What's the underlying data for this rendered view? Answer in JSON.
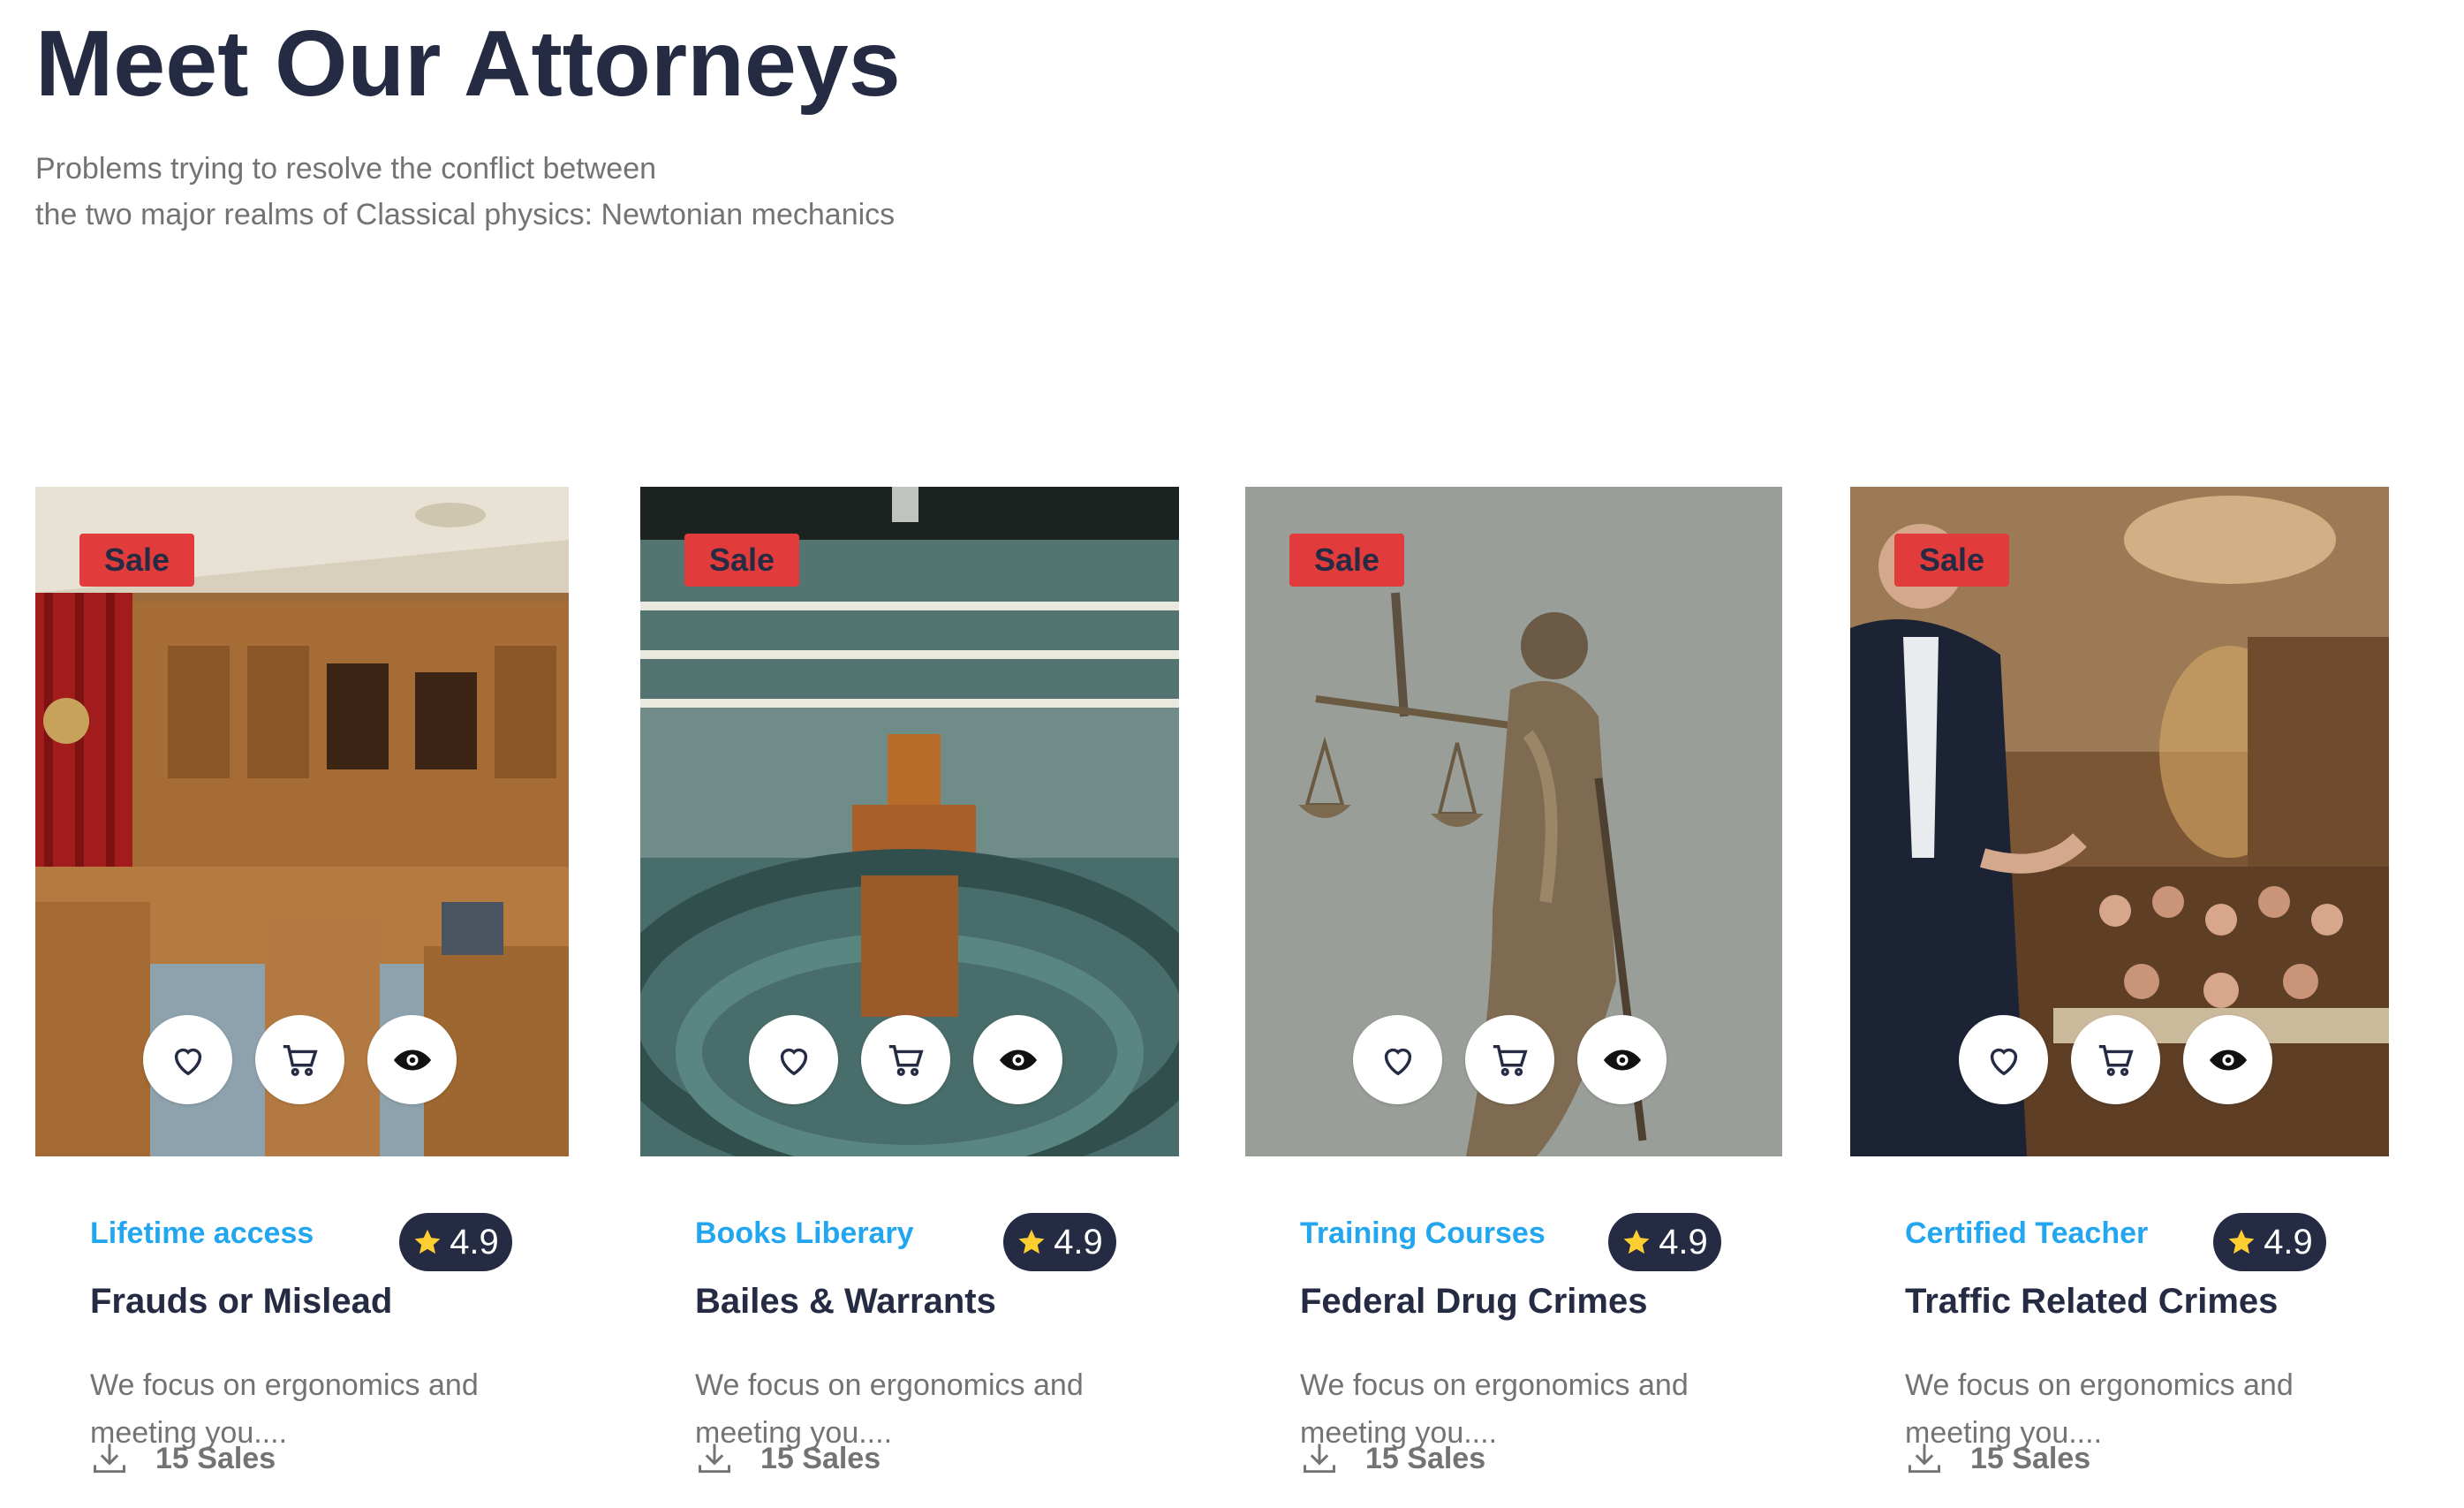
{
  "header": {
    "title": "Meet Our Attorneys",
    "subtitle_line1": "Problems trying to resolve the conflict between",
    "subtitle_line2": "the two major realms of Classical physics: Newtonian mechanics"
  },
  "colors": {
    "primary_text": "#252b42",
    "muted_text": "#737373",
    "accent_blue": "#23a6f0",
    "sale_red": "#e23b3b",
    "rating_star": "#ffce31"
  },
  "cards": [
    {
      "badge": "Sale",
      "image": "courtroom-wood-paneling",
      "category": "Lifetime access",
      "rating": "4.9",
      "title": "Frauds or Mislead",
      "description": "We focus on ergonomics and meeting you....",
      "sales": "15 Sales",
      "icons": [
        "heart-icon",
        "cart-icon",
        "eye-icon"
      ]
    },
    {
      "badge": "Sale",
      "image": "parliament-chamber",
      "category": "Books Liberary",
      "rating": "4.9",
      "title": "Bailes & Warrants",
      "description": "We focus on ergonomics and meeting you....",
      "sales": "15 Sales",
      "icons": [
        "heart-icon",
        "cart-icon",
        "eye-icon"
      ]
    },
    {
      "badge": "Sale",
      "image": "lady-justice-statue",
      "category": "Training Courses",
      "rating": "4.9",
      "title": "Federal Drug Crimes",
      "description": "We focus on ergonomics and meeting you....",
      "sales": "15 Sales",
      "icons": [
        "heart-icon",
        "cart-icon",
        "eye-icon"
      ]
    },
    {
      "badge": "Sale",
      "image": "speaker-conference-room",
      "category": "Certified Teacher",
      "rating": "4.9",
      "title": "Traffic Related Crimes",
      "description": "We focus on ergonomics and meeting you....",
      "sales": "15 Sales",
      "icons": [
        "heart-icon",
        "cart-icon",
        "eye-icon"
      ]
    }
  ]
}
